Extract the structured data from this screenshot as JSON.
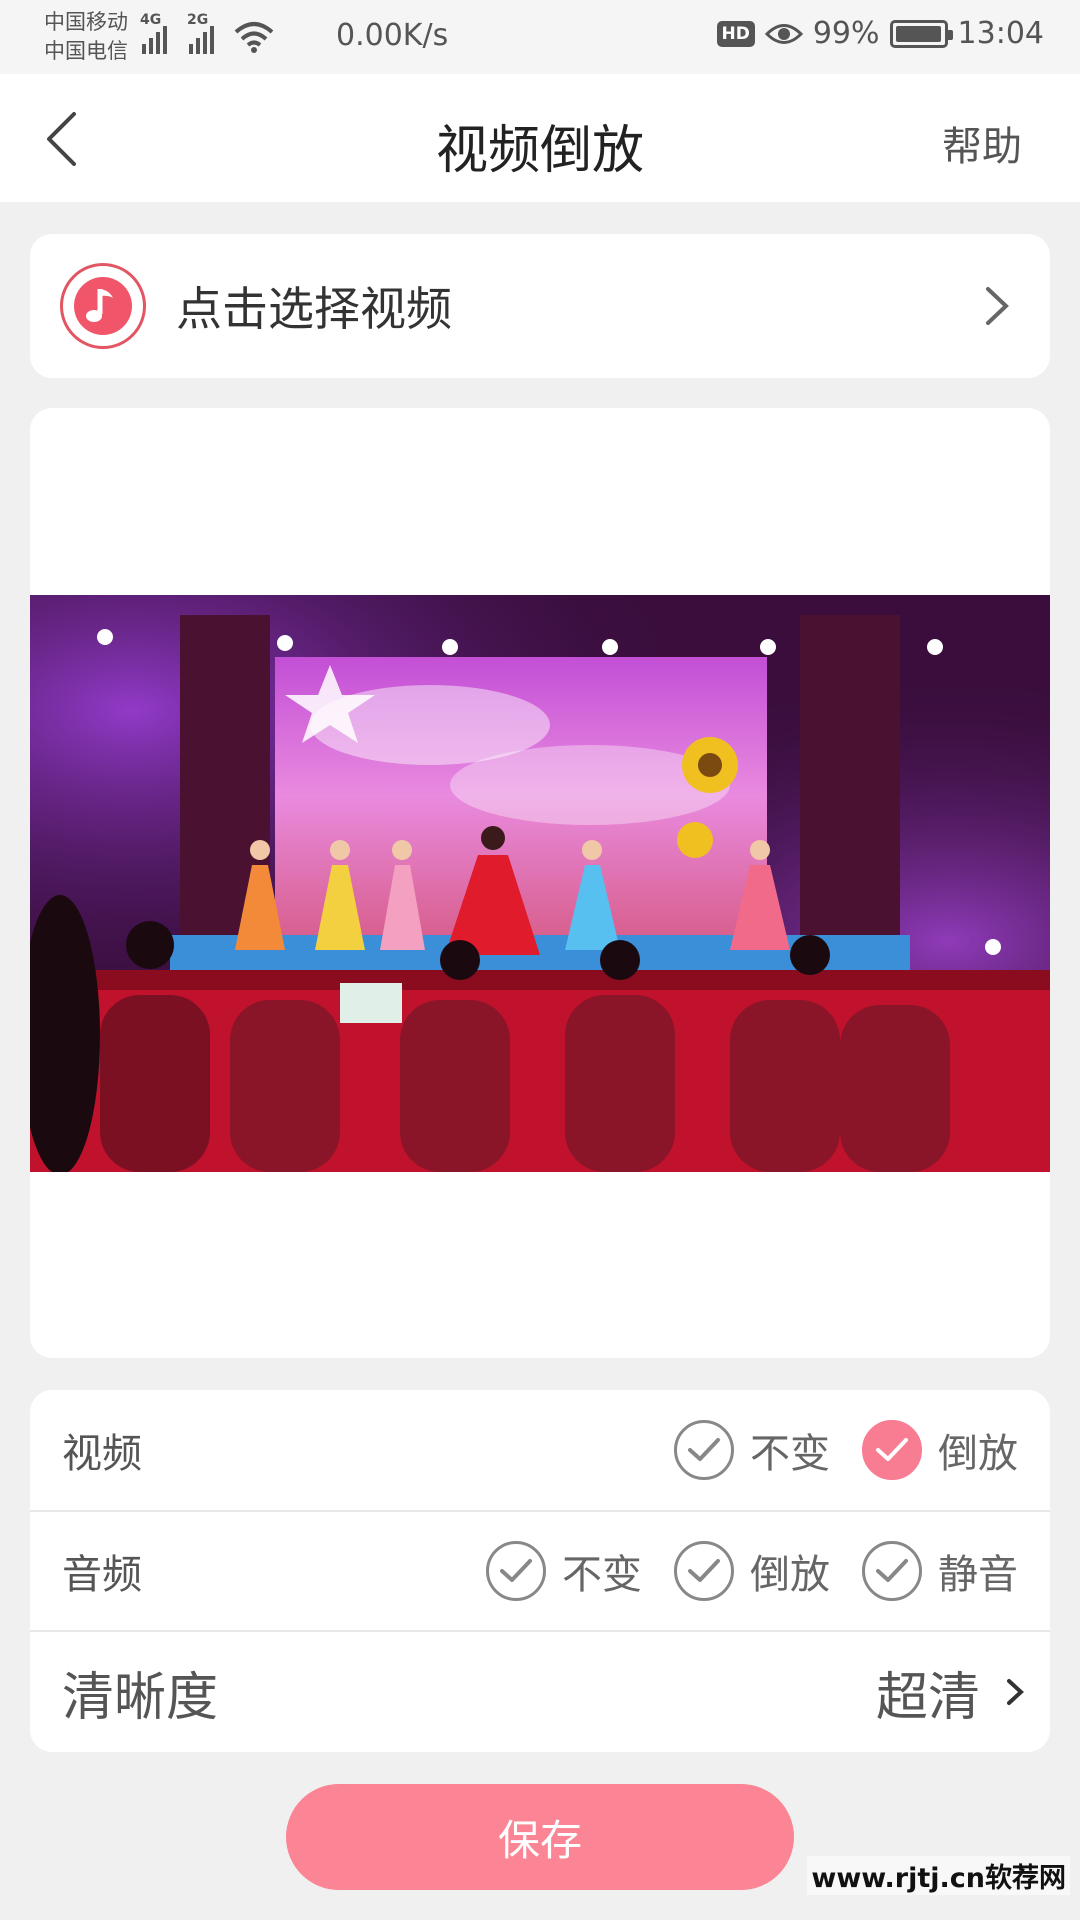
{
  "status_bar": {
    "carrier_1": "中国移动",
    "carrier_2": "中国电信",
    "net_1": "4G",
    "net_2": "2G",
    "speed": "0.00K/s",
    "hd_label": "HD",
    "battery": "99%",
    "time": "13:04",
    "battery_level": 0.99
  },
  "header": {
    "title": "视频倒放",
    "help_label": "帮助",
    "back_icon": "chevron-left-icon"
  },
  "select_video": {
    "label": "点击选择视频",
    "icon": "music-note-icon",
    "accent": "#e25563"
  },
  "options": {
    "video": {
      "label": "视频",
      "choices": [
        {
          "label": "不变",
          "checked": false
        },
        {
          "label": "倒放",
          "checked": true
        }
      ]
    },
    "audio": {
      "label": "音频",
      "choices": [
        {
          "label": "不变",
          "checked": false
        },
        {
          "label": "倒放",
          "checked": false
        },
        {
          "label": "静音",
          "checked": false
        }
      ]
    },
    "quality": {
      "label": "清晰度",
      "value": "超清"
    }
  },
  "save_label": "保存",
  "watermark": "www.rjtj.cn软荐网",
  "colors": {
    "accent_pink": "#fb8495",
    "check_on": "#f87c92"
  }
}
